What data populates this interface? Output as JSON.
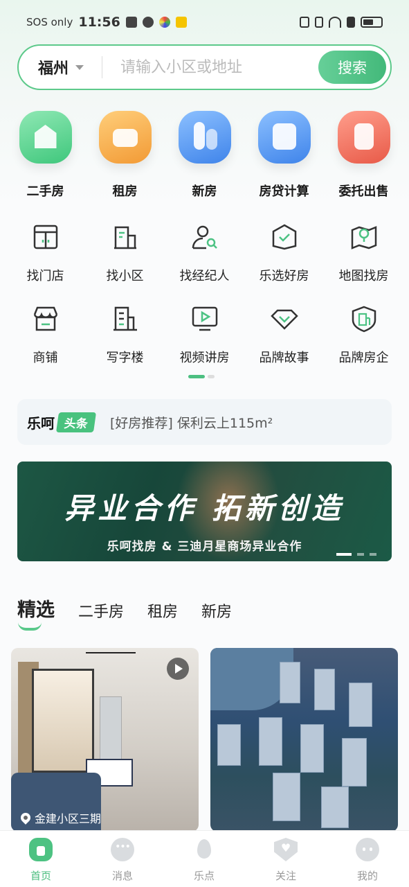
{
  "status_bar": {
    "carrier": "SOS only",
    "time": "11:56"
  },
  "search": {
    "city": "福州",
    "placeholder": "请输入小区或地址",
    "button_label": "搜索"
  },
  "primary_nav": [
    {
      "label": "二手房",
      "icon": "house-icon",
      "color": "#4ccd85"
    },
    {
      "label": "租房",
      "icon": "sofa-icon",
      "color": "#f6a843"
    },
    {
      "label": "新房",
      "icon": "building-icon",
      "color": "#4a8df0"
    },
    {
      "label": "房贷计算",
      "icon": "calculator-icon",
      "color": "#4a8df0"
    },
    {
      "label": "委托出售",
      "icon": "document-icon",
      "color": "#ef6b5a"
    }
  ],
  "secondary_nav_row1": [
    {
      "label": "找门店",
      "icon": "store-door-icon"
    },
    {
      "label": "找小区",
      "icon": "building-icon"
    },
    {
      "label": "找经纪人",
      "icon": "agent-search-icon"
    },
    {
      "label": "乐选好房",
      "icon": "check-house-icon"
    },
    {
      "label": "地图找房",
      "icon": "map-pin-icon"
    }
  ],
  "secondary_nav_row2": [
    {
      "label": "商铺",
      "icon": "shop-icon"
    },
    {
      "label": "写字楼",
      "icon": "office-icon"
    },
    {
      "label": "视频讲房",
      "icon": "video-play-icon"
    },
    {
      "label": "品牌故事",
      "icon": "diamond-icon"
    },
    {
      "label": "品牌房企",
      "icon": "shield-building-icon"
    }
  ],
  "headline": {
    "brand": "乐呵",
    "tag": "头条",
    "text": "[好房推荐] 保利云上115m²"
  },
  "banner": {
    "title": "异业合作 拓新创造",
    "subtitle": "乐呵找房 & 三迪月星商场异业合作"
  },
  "tabs": [
    {
      "label": "精选",
      "active": true
    },
    {
      "label": "二手房",
      "active": false
    },
    {
      "label": "租房",
      "active": false
    },
    {
      "label": "新房",
      "active": false
    }
  ],
  "cards": [
    {
      "location": "金建小区三期",
      "has_video": true
    }
  ],
  "bottom_nav": [
    {
      "label": "首页",
      "icon": "home-icon",
      "active": true
    },
    {
      "label": "消息",
      "icon": "message-icon",
      "active": false
    },
    {
      "label": "乐点",
      "icon": "fire-icon",
      "active": false
    },
    {
      "label": "关注",
      "icon": "heart-shield-icon",
      "active": false
    },
    {
      "label": "我的",
      "icon": "profile-icon",
      "active": false
    }
  ],
  "colors": {
    "accent": "#4cc283",
    "banner_bg": "#1d5744"
  }
}
